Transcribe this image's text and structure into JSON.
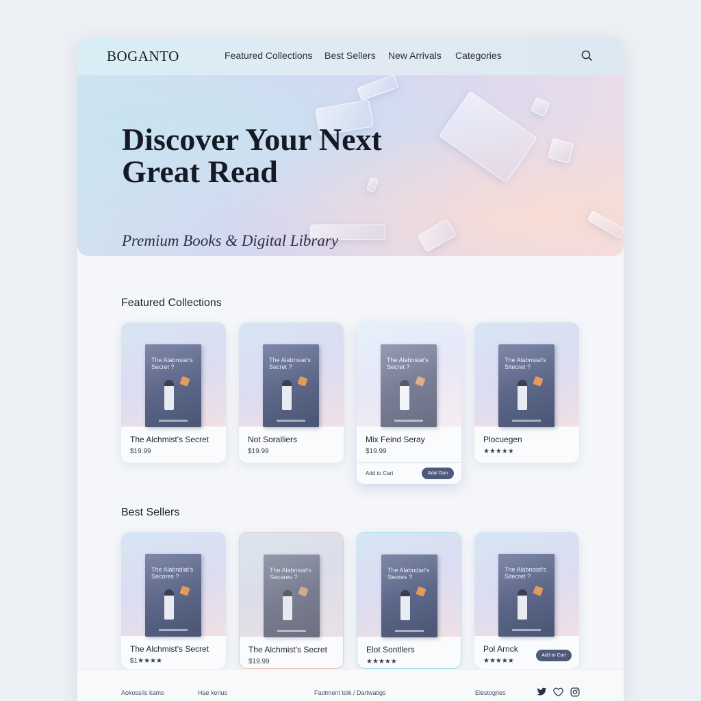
{
  "brand": {
    "logo": "BOGANTO"
  },
  "nav": {
    "items": [
      "Featured Collections",
      "Best Sellers",
      "New Arrivals",
      "Categories"
    ],
    "search_icon": "search-icon"
  },
  "hero": {
    "title": "Discover Your Next Great Read",
    "subtitle": "Premium Books & Digital Library"
  },
  "featured": {
    "title": "Featured Collections",
    "cards": [
      {
        "cover_title": "The Alabnsiat's Secret ?",
        "name": "The Alchmist's Secret",
        "price": "$19.99"
      },
      {
        "cover_title": "The Alabnsiat's Secret ?",
        "name": "Not Soralliers",
        "price": "$19.99"
      },
      {
        "cover_title": "The Alabnsiat's Secret ?",
        "name": "Mix Feind Seray",
        "price": "$19.99",
        "add_to_cart_text": "Add to Cart",
        "add_button": "Adal Gan"
      },
      {
        "cover_title": "The Alabnsiat's Sitecret ?",
        "name": "Plocuegen",
        "rating": "★★★★★"
      }
    ]
  },
  "bestsellers": {
    "title": "Best Sellers",
    "cards": [
      {
        "cover_title": "The Alabndiat's Secores ?",
        "name": "The Alchmist's Secret",
        "price": "$1★★★★"
      },
      {
        "cover_title": "The Alabnsiat's Secares ?",
        "name": "The Alchmist's Secret",
        "price": "$19.99"
      },
      {
        "cover_title": "The Alabndiat's Seores ?",
        "name": "Elot Sontllers",
        "rating": "★★★★★"
      },
      {
        "cover_title": "The Alabnsiat's Sitecret ?",
        "name": "Pol Arnck",
        "rating": "★★★★★",
        "add_button": "Add to Cart"
      }
    ]
  },
  "footer": {
    "links": [
      "Aokoss/is kams",
      "Hae kenus",
      "Faotment toik / Dartwatigs",
      "Elestogries"
    ],
    "social": [
      "twitter-icon",
      "heart-icon",
      "instagram-icon"
    ]
  },
  "colors": {
    "accent": "#4d5a7a",
    "background": "#edf0f4"
  }
}
